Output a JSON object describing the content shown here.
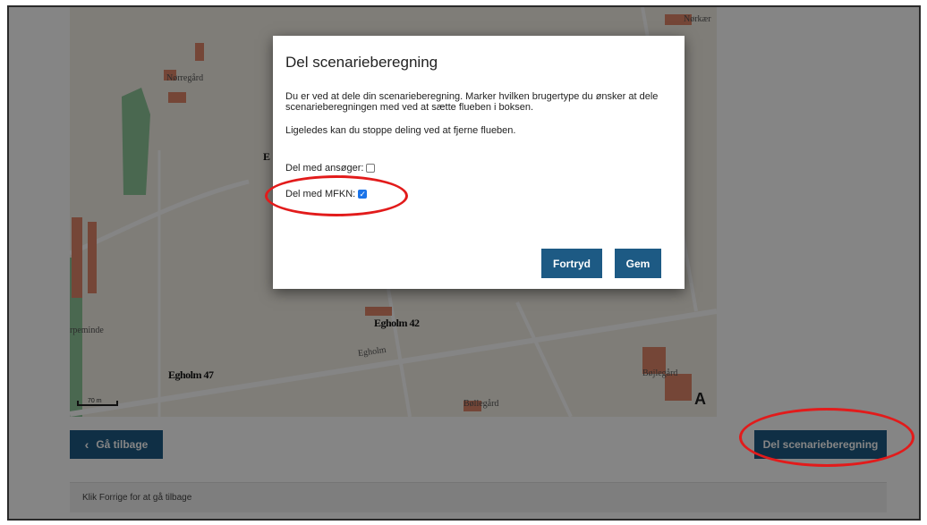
{
  "map": {
    "labels": {
      "norregard": "Nørregård",
      "norkaer": "Nørkær",
      "egholm_road": "Egholm",
      "bojlegard": "Bøjlegård",
      "bollegard": "Bøllegård",
      "perminde": "rpeminde",
      "scale": "70 m"
    },
    "addresses": {
      "egholm42": "Egholm 42",
      "egholm47": "Egholm 47",
      "partial_e": "E"
    },
    "north_symbol": "A"
  },
  "nav": {
    "back_label": "Gå tilbage",
    "back_icon": "‹",
    "share_label": "Del scenarieberegning"
  },
  "footer": {
    "text": "Klik Forrige for at gå tilbage"
  },
  "modal": {
    "title": "Del scenarieberegning",
    "text": "Du er ved at dele din scenarieberegning. Marker hvilken brugertype du ønsker at dele scenarieberegningen med ved at sætte flueben i boksen.",
    "text2": "Ligeledes kan du stoppe deling ved at fjerne flueben.",
    "checkbox_ansoger_label": "Del med ansøger:",
    "checkbox_ansoger_checked": false,
    "checkbox_mfkn_label": "Del med MFKN:",
    "checkbox_mfkn_checked": true,
    "cancel_label": "Fortryd",
    "save_label": "Gem"
  },
  "colors": {
    "button": "#1d5a84",
    "annotation": "#e21b1b"
  }
}
